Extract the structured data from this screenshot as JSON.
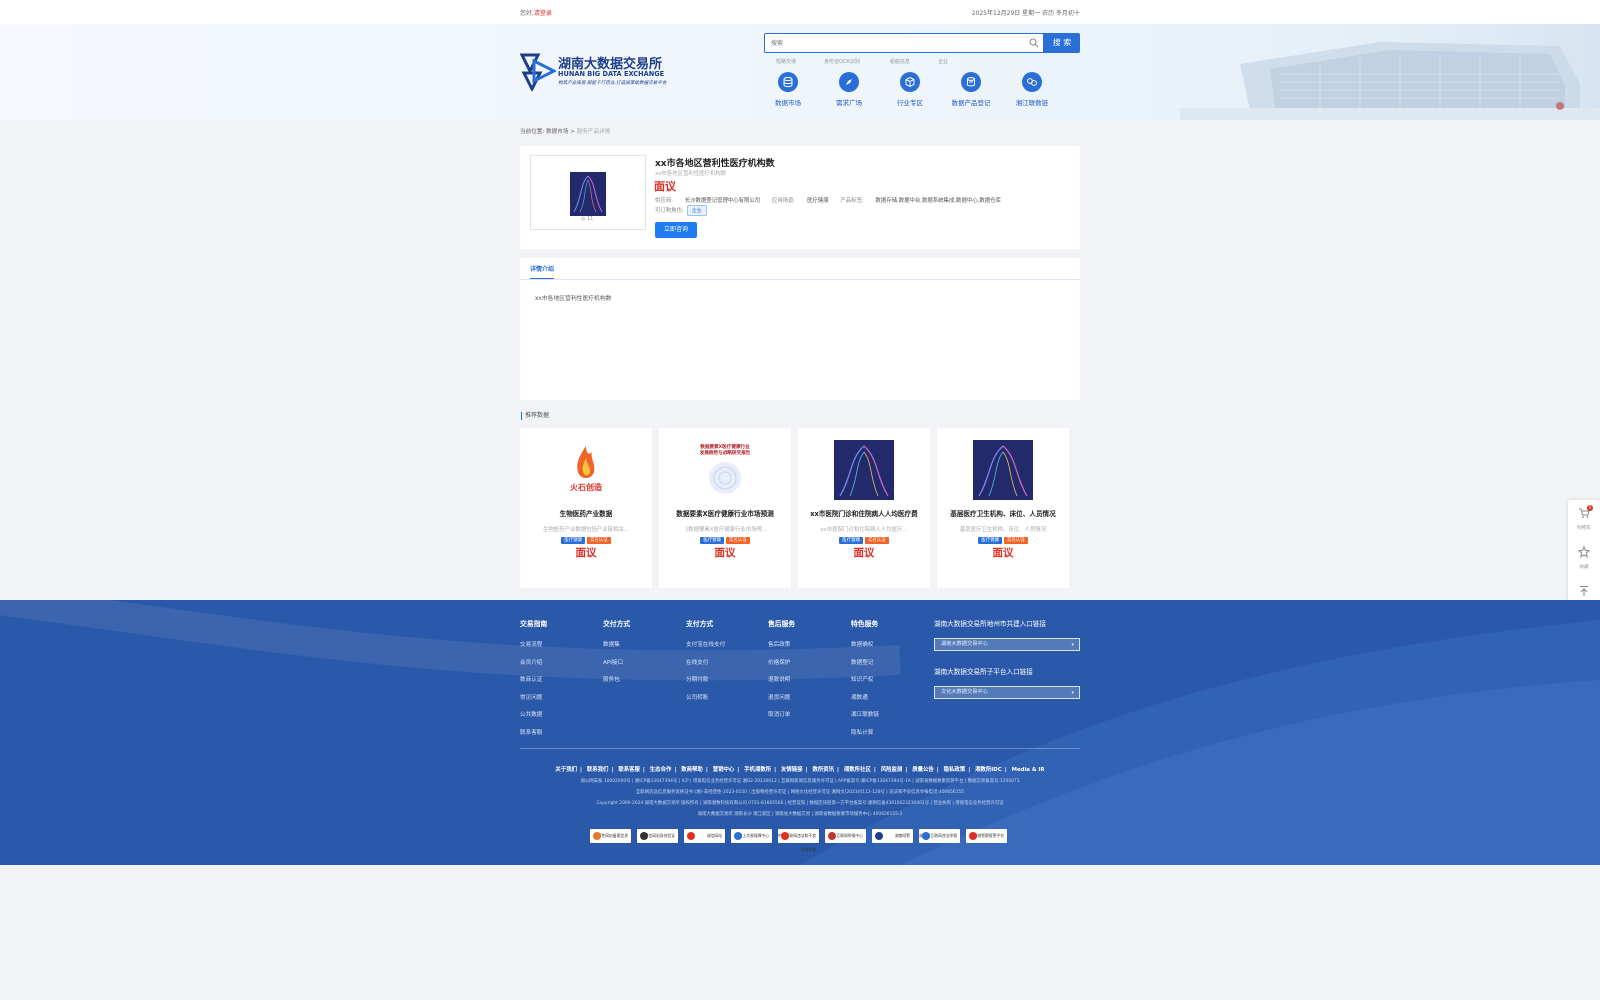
{
  "topbar": {
    "greeting": "您好,",
    "login": "请登录",
    "date": "2025年12月29日 星期一 农历 冬月初十"
  },
  "logo": {
    "cn": "湖南大数据交易所",
    "en": "HUNAN BIG DATA EXCHANGE",
    "slogan": "构筑产业底层,赋能千行百业,打造国家级数据交易平台"
  },
  "search": {
    "placeholder": "搜索",
    "button": "搜 索",
    "hotwords": [
      "短路交通",
      "身份证OCR识别",
      "船舶信息",
      "企业"
    ]
  },
  "nav": [
    {
      "label": "数据市场",
      "icon": "database-icon"
    },
    {
      "label": "需求广场",
      "icon": "compass-icon"
    },
    {
      "label": "行业专区",
      "icon": "cube-icon"
    },
    {
      "label": "数据产品登记",
      "icon": "register-icon"
    },
    {
      "label": "湘江联数链",
      "icon": "link-icon"
    }
  ],
  "breadcrumb": {
    "prefix": "当前位置:",
    "parent": "数据市场",
    "sep": ">",
    "current": "服务产品详情"
  },
  "product": {
    "title": "xx市各地区营利性医疗机构数",
    "subtitle": "xx市各地区营利性医疗机构数",
    "price": "面议",
    "thumb_count": "◎ 11",
    "provider_label": "供应商:",
    "provider": "长沙数据登记管理中心有限公司",
    "scene_label": "应用场景:",
    "scene": "医疗健康",
    "tags_label": "产品标签:",
    "tags": "数据存储,数据中台,数据系统集成,数据中心,数据仓库",
    "role_label": "可订购角色:",
    "role": "企业",
    "consult_button": "立即咨询"
  },
  "detail": {
    "tab": "详情介绍",
    "body": "xx市各地区营利性医疗机构数"
  },
  "recommend": {
    "title": "推荐数据",
    "items": [
      {
        "name": "生物医药产业数据",
        "desc": "生物医药产业数据包括产业链相关...",
        "tag1": "医疗健康",
        "tag2": "实名认证",
        "price": "面议",
        "img": "fire"
      },
      {
        "name": "数据要素X医疗健康行业市场预测",
        "desc": "《数据要素X医疗健康行业市场预...",
        "tag1": "医疗健康",
        "tag2": "实名认证",
        "price": "面议",
        "img": "report"
      },
      {
        "name": "xx市医院门诊和住院病人人均医疗费",
        "desc": "xx市医院门诊和住院病人人均医疗...",
        "tag1": "医疗健康",
        "tag2": "实名认证",
        "price": "面议",
        "img": "blue"
      },
      {
        "name": "基层医疗卫生机构、床位、人员情况",
        "desc": "基层医疗卫生机构、床位、人员情况",
        "tag1": "医疗健康",
        "tag2": "实名认证",
        "price": "面议",
        "img": "blue"
      }
    ],
    "report_text": "数据要素X医疗健康行业\n发展趋势与战略研究报告"
  },
  "float": [
    {
      "label": "购物车",
      "icon": "cart-icon",
      "badge": "0"
    },
    {
      "label": "收藏",
      "icon": "star-icon"
    },
    {
      "label": "顶部",
      "icon": "top-icon"
    }
  ],
  "footer": {
    "columns": [
      {
        "title": "交易指南",
        "items": [
          "交易流程",
          "会员介绍",
          "数商认证",
          "常见问题",
          "公共数据",
          "联系客服"
        ]
      },
      {
        "title": "交付方式",
        "items": [
          "数据集",
          "API接口",
          "服务包"
        ]
      },
      {
        "title": "支付方式",
        "items": [
          "支付宝在线支付",
          "在线支付",
          "分期付款",
          "公司转账"
        ]
      },
      {
        "title": "售后服务",
        "items": [
          "售后政策",
          "价格保护",
          "退款说明",
          "退货问题",
          "取消订单"
        ]
      },
      {
        "title": "特色服务",
        "items": [
          "数据确权",
          "数据登记",
          "知识产权",
          "湘数通",
          "湘江联数链",
          "隐私计算"
        ]
      }
    ],
    "link1_title": "湖南大数据交易所地州市共建入口链接",
    "link1_value": "湖南大数据交易中心",
    "link2_title": "湖南大数据交易所子平台入口链接",
    "link2_value": "文化大数据交易中心",
    "nav": [
      "关于我们",
      "联系我们",
      "联系客服",
      "生态合作",
      "数商帮助",
      "营销中心",
      "手机湘数所",
      "友情链接",
      "数所资讯",
      "湘数所社区",
      "风险监测",
      "质量公告",
      "隐私政策",
      "湘数所IDC",
      "Media & IR"
    ],
    "line1": "湖公网安备 10002000号 | 湘ICP备13047394号 | ICP | 增值电信业务经营许可证:湘B2-20230012 | 互联网新闻信息服务许可证 | APP备案号:湘ICP备13047394号-1A | 湖南省数据要素监管平台 | 数据交易备案号:1200071",
    "line2": "互联网药品信息服务资格证书:(湘)-非经营性-2023-0150 | 出版物经营许可证 | 网络文化经营许可证:湘网文[2023]0112-128号 | 违法和不良信息举报电话:400656155",
    "line3": "Copyright 2000-2024 湖南大数据交易所 版权所有 | 湖南湘数科技有限公司 0731-81665566 | 经营证照 | 数据区块链第一方平台备案号:湘网信备43010023230001号 | 营业执照 | 增值电信业务经营许可证",
    "line4": "湖南大数据交易所 湖南长沙 湘江新区 | 湖南省大数据交易 | 湖南省数据要素市场服务中心 400656155-3",
    "badges": [
      "经营性网站备案信息",
      "可信网站身份验证",
      "诚信网站",
      "网上交易保障中心",
      "中国互联网违法和不良信息举报",
      "互联网举报中心",
      "湖南网警",
      "湖南省互联网违法举报",
      "网络警察报警平台"
    ]
  }
}
